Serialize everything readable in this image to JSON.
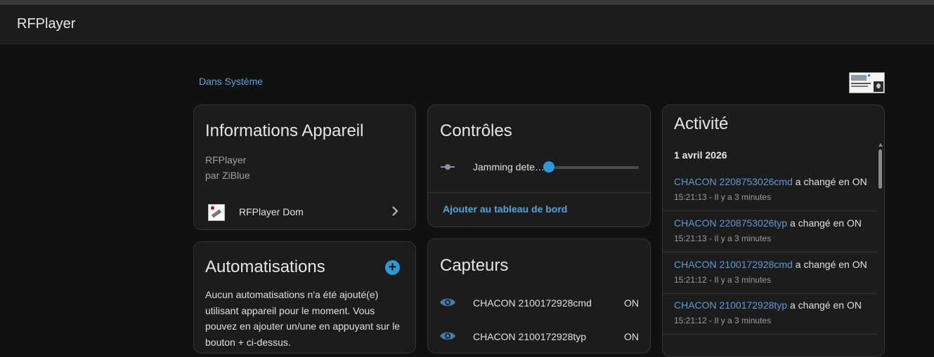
{
  "app": {
    "title": "RFPlayer"
  },
  "breadcrumb": {
    "label": "Dans Système"
  },
  "device_info": {
    "title": "Informations Appareil",
    "model": "RFPlayer",
    "manufacturer": "par ZiBlue",
    "hub": {
      "label": "RFPlayer Dom",
      "icon": "chevron-right-icon"
    }
  },
  "controls": {
    "title": "Contrôles",
    "items": [
      {
        "label": "Jamming dete…",
        "value": 0
      }
    ],
    "action": "Ajouter au tableau de bord"
  },
  "automations": {
    "title": "Automatisations",
    "empty_text": "Aucun automatisations n'a été ajouté(e) utilisant appareil pour le moment. Vous pouvez en ajouter un/une en appuyant sur le bouton + ci-dessus.",
    "add_icon": "plus-circle-icon"
  },
  "sensors": {
    "title": "Capteurs",
    "items": [
      {
        "name": "CHACON 2100172928cmd",
        "state": "ON"
      },
      {
        "name": "CHACON 2100172928typ",
        "state": "ON"
      }
    ]
  },
  "activity": {
    "title": "Activité",
    "date": "1 avril 2026",
    "entries": [
      {
        "entity": "CHACON 2208753026cmd",
        "message": "a changé en ON",
        "time": "15:21:13 - Il y a 3 minutes"
      },
      {
        "entity": "CHACON 2208753026typ",
        "message": "a changé en ON",
        "time": "15:21:13 - Il y a 3 minutes"
      },
      {
        "entity": "CHACON 2100172928cmd",
        "message": "a changé en ON",
        "time": "15:21:12 - Il y a 3 minutes"
      },
      {
        "entity": "CHACON 2100172928typ",
        "message": "a changé en ON",
        "time": "15:21:12 - Il y a 3 minutes"
      }
    ]
  },
  "colors": {
    "accent": "#2a9bd8",
    "link": "#4fa8e0",
    "entity_link": "#5d9ad6",
    "background": "#111111",
    "card": "#1c1c1c"
  }
}
